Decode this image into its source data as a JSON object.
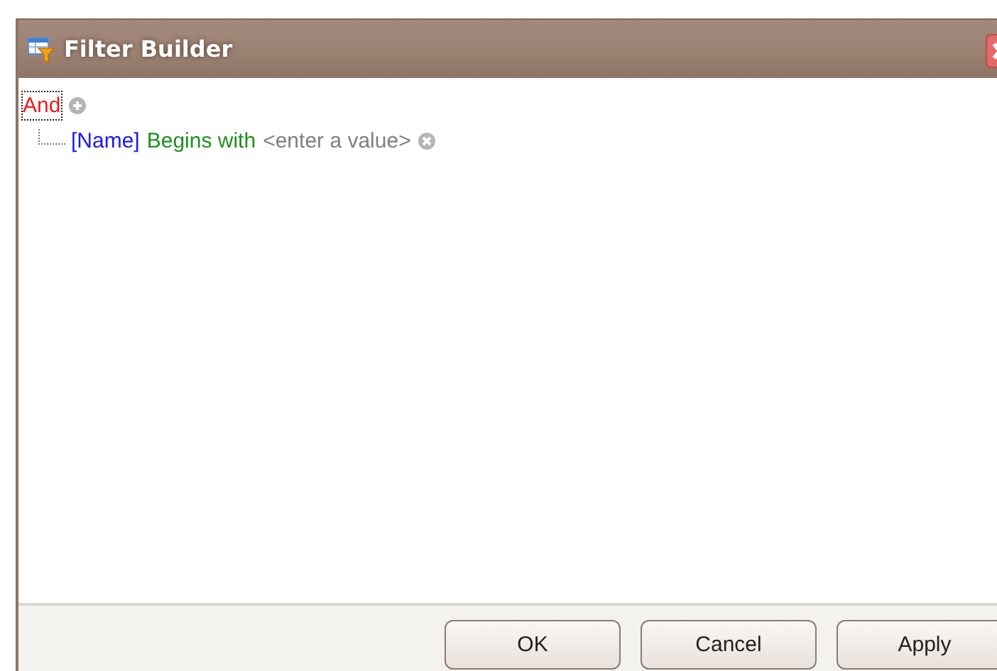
{
  "window": {
    "title": "Filter Builder"
  },
  "filter": {
    "operator": "And",
    "focused": true,
    "conditions": [
      {
        "field": "[Name]",
        "operation": "Begins with",
        "value": "<enter a value>"
      }
    ]
  },
  "buttons": [
    "OK",
    "Cancel",
    "Apply"
  ]
}
